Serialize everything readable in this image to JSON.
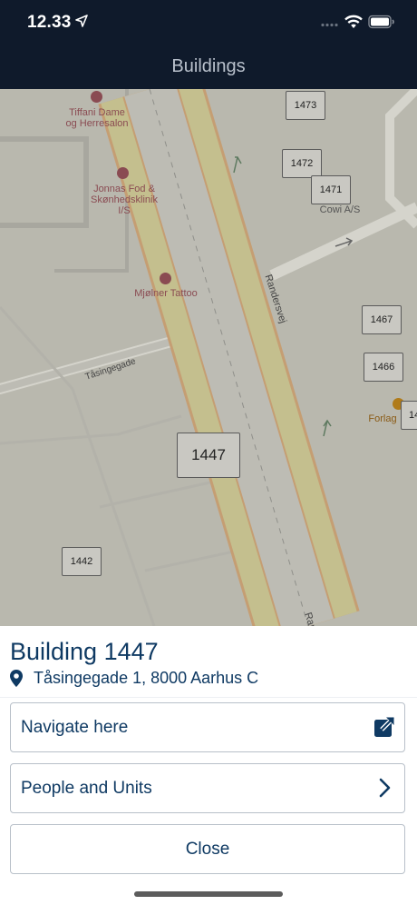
{
  "status_bar": {
    "time": "12.33"
  },
  "nav": {
    "title": "Buildings"
  },
  "map": {
    "buildings": [
      "1473",
      "1472",
      "1471",
      "1467",
      "1466",
      "1447",
      "1442",
      "14"
    ],
    "pois": [
      {
        "name": "Tiffani Dame\nog Herresalon"
      },
      {
        "name": "Jonnas Fod &\nSkønhedsklinik\nI/S"
      },
      {
        "name": "Mjølner Tattoo"
      },
      {
        "name": "Cowi A/S"
      },
      {
        "name": "Forlag"
      }
    ],
    "roads": [
      "Randersvej",
      "Tåsingegade",
      "Ran"
    ]
  },
  "sheet": {
    "building_title": "Building 1447",
    "address": "Tåsingegade 1, 8000 Aarhus C",
    "navigate_label": "Navigate here",
    "people_label": "People and Units",
    "close_label": "Close"
  },
  "colors": {
    "nav_bg": "#0f1a2b",
    "accent": "#0f3a63",
    "map_bg": "#b9b8ae"
  }
}
